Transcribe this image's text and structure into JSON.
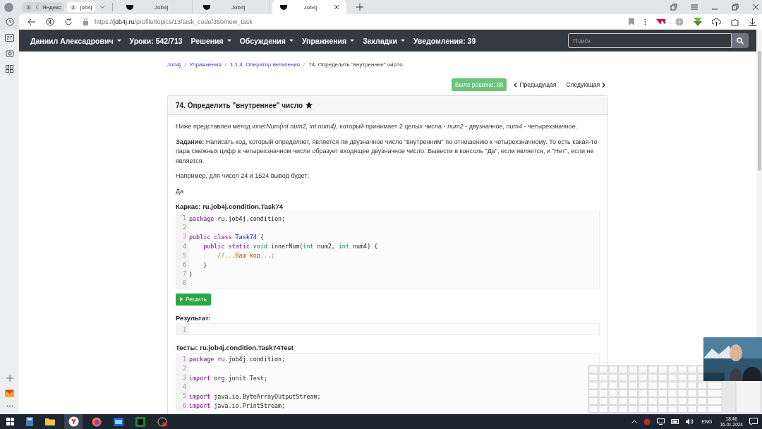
{
  "browser": {
    "tab_groups": [
      {
        "count": "3",
        "label": "Яндекс",
        "selected": false
      },
      {
        "count": "3",
        "label": "job4j",
        "selected": true
      }
    ],
    "tabs": [
      {
        "label": "Job4j",
        "selected": false
      },
      {
        "label": "Job4j",
        "selected": false
      },
      {
        "label": "Job4j",
        "selected": true
      }
    ],
    "url": {
      "scheme": "https://",
      "host": "job4j.ru",
      "path": "/profile/topics/13/task_code/350/new_task"
    },
    "sidebar_calendar_day": "27"
  },
  "navbar": {
    "items": [
      {
        "label": "Даниил Алексадрович",
        "dropdown": true
      },
      {
        "label": "Уроки: 542/713",
        "dropdown": false
      },
      {
        "label": "Решения",
        "dropdown": true
      },
      {
        "label": "Обсуждения",
        "dropdown": true
      },
      {
        "label": "Упражнения",
        "dropdown": true
      },
      {
        "label": "Закладки",
        "dropdown": true
      },
      {
        "label": "Уведомления: 39",
        "dropdown": false
      }
    ],
    "search": {
      "placeholder": "Поиск"
    }
  },
  "breadcrumbs": [
    {
      "label": "Job4j",
      "link": true
    },
    {
      "separator": "/",
      "label": "Упражнения",
      "link": true
    },
    {
      "separator": "/",
      "label": "1.1.4. Оператор ветвления",
      "link": true
    },
    {
      "separator": "/",
      "label": "74. Определить \"внутреннее\" число",
      "link": false
    }
  ],
  "pager": {
    "solved": "Было решено: 68",
    "previous": "Предыдущая",
    "next": "Следующая"
  },
  "task": {
    "title": "74. Определить \"внутреннее\" число",
    "starred": true,
    "paragraphs": [
      "Ниже представлен метод *innerNum(int num2, int num4)*, который принимает 2 целых числа - *num2* - двузначное, *num4* - четырехзначное.",
      "**Задание:** Написать код, который определяет, является ли двузначное число \"внутренним\" по отношению к четырехзначному. То есть какая-то пара смежных цифр в четырехзначном числе образует входящее двузначное число. Вывести в консоль \"Да\", если является, и \"Нет\", если не является.",
      "Например, для чисел 24 и 1524 вывод будет:",
      "Да"
    ],
    "skeleton": {
      "label": "Каркас: ru.job4j.condition.Task74",
      "lines": [
        {
          "number": "1",
          "tokens": [
            {
              "kind": "keyword",
              "text": "package"
            },
            {
              "kind": "plain",
              "text": " ru.job4j.condition;"
            }
          ]
        },
        {
          "number": "2"
        },
        {
          "number": "3",
          "tokens": [
            {
              "kind": "keyword",
              "text": "public class"
            },
            {
              "kind": "def",
              "text": " Task74"
            },
            {
              "kind": "plain",
              "text": " {"
            }
          ]
        },
        {
          "number": "4",
          "tokens": [
            {
              "kind": "keyword",
              "text": "    public static"
            },
            {
              "kind": "type",
              "text": " void"
            },
            {
              "kind": "plain",
              "text": " innerNum("
            },
            {
              "kind": "type",
              "text": "int"
            },
            {
              "kind": "plain",
              "text": " num2, "
            },
            {
              "kind": "type",
              "text": "int"
            },
            {
              "kind": "plain",
              "text": " num4) {"
            }
          ]
        },
        {
          "number": "5",
          "tokens": [
            {
              "kind": "comment",
              "text": "        //...Ваш код...;"
            }
          ]
        },
        {
          "number": "6",
          "tokens": [
            {
              "kind": "plain",
              "text": "    }"
            }
          ]
        },
        {
          "number": "7",
          "tokens": [
            {
              "kind": "plain",
              "text": "}"
            }
          ]
        },
        {
          "number": "8"
        }
      ]
    },
    "solve_button": "Решить",
    "result": {
      "label": "Результат:",
      "lines": [
        {
          "number": "1"
        }
      ]
    },
    "tests": {
      "label": "Тесты: ru.job4j.condition.Task74Test",
      "lines": [
        {
          "number": "1",
          "tokens": [
            {
              "kind": "keyword",
              "text": "package"
            },
            {
              "kind": "plain",
              "text": " ru.job4j.condition;"
            }
          ]
        },
        {
          "number": "2"
        },
        {
          "number": "3",
          "tokens": [
            {
              "kind": "keyword",
              "text": "import"
            },
            {
              "kind": "plain",
              "text": " org.junit.Test;"
            }
          ]
        },
        {
          "number": "4"
        },
        {
          "number": "5",
          "tokens": [
            {
              "kind": "keyword",
              "text": "import"
            },
            {
              "kind": "plain",
              "text": " java.io.ByteArrayOutputStream;"
            }
          ]
        },
        {
          "number": "6",
          "tokens": [
            {
              "kind": "keyword",
              "text": "import"
            },
            {
              "kind": "plain",
              "text": " java.io.PrintStream;"
            }
          ]
        }
      ]
    }
  },
  "taskbar": {
    "language": "ENG",
    "time": "18:46",
    "date": "16.01.2024"
  }
}
